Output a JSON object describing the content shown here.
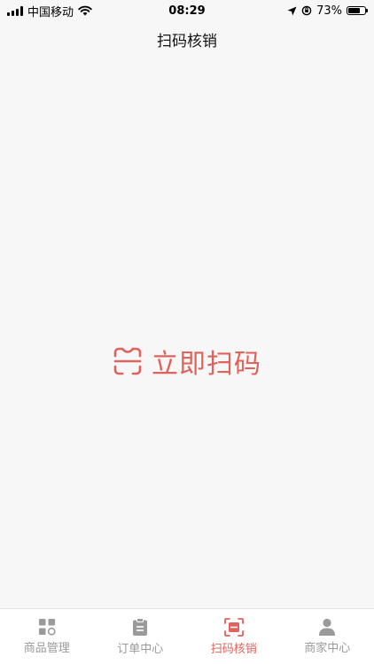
{
  "status_bar": {
    "carrier": "中国移动",
    "time": "08:29",
    "battery_percent": "73%",
    "battery_level": 0.73
  },
  "nav": {
    "title": "扫码核销"
  },
  "main": {
    "scan_label": "立即扫码",
    "accent_color": "#e0625c"
  },
  "tab_bar": {
    "active_index": 2,
    "items": [
      {
        "label": "商品管理",
        "icon": "grid-icon"
      },
      {
        "label": "订单中心",
        "icon": "clipboard-icon"
      },
      {
        "label": "扫码核销",
        "icon": "scan-icon"
      },
      {
        "label": "商家中心",
        "icon": "person-icon"
      }
    ]
  }
}
